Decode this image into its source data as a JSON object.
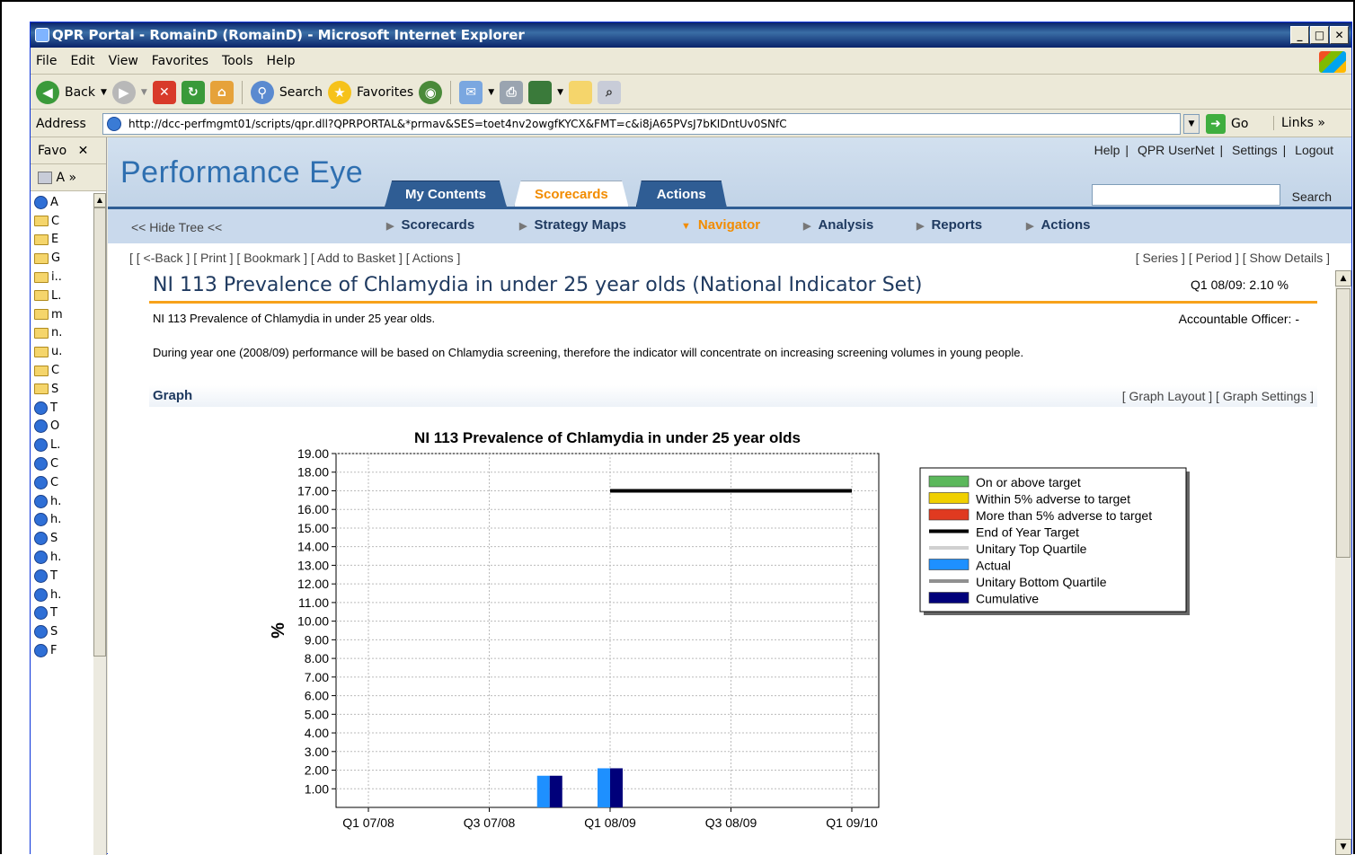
{
  "window": {
    "title": "QPR Portal - RomainD (RomainD) - Microsoft Internet Explorer",
    "buttons": [
      "_",
      "□",
      "✕"
    ]
  },
  "menu": [
    "File",
    "Edit",
    "View",
    "Favorites",
    "Tools",
    "Help"
  ],
  "toolbar": {
    "back": "Back",
    "search": "Search",
    "favorites": "Favorites"
  },
  "address": {
    "label": "Address",
    "url": "http://dcc-perfmgmt01/scripts/qpr.dll?QPRPORTAL&*prmav&SES=toet4nv2owgfKYCX&FMT=c&i8jA65PVsJ7bKIDntUv0SNfC",
    "go": "Go",
    "links": "Links"
  },
  "favorites": {
    "header": "Favo",
    "close": "✕",
    "sub": "A",
    "items": [
      {
        "type": "ie",
        "label": "A"
      },
      {
        "type": "folder",
        "label": "C"
      },
      {
        "type": "folder",
        "label": "E"
      },
      {
        "type": "folder",
        "label": "G"
      },
      {
        "type": "folder",
        "label": "i.."
      },
      {
        "type": "folder",
        "label": "L."
      },
      {
        "type": "folder",
        "label": "m"
      },
      {
        "type": "folder",
        "label": "n."
      },
      {
        "type": "folder",
        "label": "u."
      },
      {
        "type": "folder",
        "label": "C"
      },
      {
        "type": "folder",
        "label": "S"
      },
      {
        "type": "ie",
        "label": "T"
      },
      {
        "type": "ie",
        "label": "O"
      },
      {
        "type": "ie",
        "label": "L."
      },
      {
        "type": "ie",
        "label": "C"
      },
      {
        "type": "ie",
        "label": "C"
      },
      {
        "type": "ie",
        "label": "h."
      },
      {
        "type": "ie",
        "label": "h."
      },
      {
        "type": "ie",
        "label": "S"
      },
      {
        "type": "ie",
        "label": "h."
      },
      {
        "type": "ie",
        "label": "T"
      },
      {
        "type": "ie",
        "label": "h."
      },
      {
        "type": "ie",
        "label": "T"
      },
      {
        "type": "ie",
        "label": "S"
      },
      {
        "type": "ie",
        "label": "F"
      }
    ]
  },
  "portal": {
    "brand": "Performance Eye",
    "toplinks": [
      "Help",
      "QPR UserNet",
      "Settings",
      "Logout"
    ],
    "search_label": "Search",
    "tabs": [
      {
        "label": "My Contents",
        "active": false
      },
      {
        "label": "Scorecards",
        "active": true
      },
      {
        "label": "Actions",
        "active": false
      }
    ],
    "hide_tree": "<< Hide Tree <<",
    "subnav": [
      {
        "label": "Scorecards",
        "active": false
      },
      {
        "label": "Strategy Maps",
        "active": false
      },
      {
        "label": "Navigator",
        "active": true
      },
      {
        "label": "Analysis",
        "active": false
      },
      {
        "label": "Reports",
        "active": false
      },
      {
        "label": "Actions",
        "active": false
      }
    ],
    "actions_left": "[ [ <-Back ] [ Print ] [ Bookmark ] [ Add to Basket ] [ Actions ]",
    "actions_right": "[ Series ] [ Period ] [ Show Details ]"
  },
  "indicator": {
    "title": "NI 113 Prevalence of Chlamydia in under 25 year olds (National Indicator Set)",
    "value": "Q1 08/09: 2.10 %",
    "short": "NI 113 Prevalence of Chlamydia in under 25 year olds.",
    "officer": "Accountable Officer: -",
    "description": "During year one (2008/09) performance will be based on Chlamydia screening, therefore the indicator will concentrate on increasing screening volumes in young people.",
    "graph_label": "Graph",
    "graph_links": "[ Graph Layout ] [ Graph Settings ]"
  },
  "colors": {
    "green": "#5cb85c",
    "yellow": "#f0d000",
    "red": "#e03a20",
    "black": "#000000",
    "toplight": "#d0d0d0",
    "actual": "#1e90ff",
    "bottomgray": "#909090",
    "cumulative": "#00007a"
  },
  "chart_data": {
    "type": "bar",
    "title": "NI 113 Prevalence of Chlamydia in under 25 year olds",
    "ylabel": "%",
    "ylim": [
      0,
      19
    ],
    "yticks": [
      "1.00",
      "2.00",
      "3.00",
      "4.00",
      "5.00",
      "6.00",
      "7.00",
      "8.00",
      "9.00",
      "10.00",
      "11.00",
      "12.00",
      "13.00",
      "14.00",
      "15.00",
      "16.00",
      "17.00",
      "18.00",
      "19.00"
    ],
    "xticks": [
      "Q1 07/08",
      "Q3 07/08",
      "Q1 08/09",
      "Q3 08/09",
      "Q1 09/10"
    ],
    "grid": true,
    "legend_position": "right",
    "legend": [
      {
        "label": "On or above target",
        "kind": "box",
        "color": "#5cb85c"
      },
      {
        "label": "Within 5% adverse to target",
        "kind": "box",
        "color": "#f0d000"
      },
      {
        "label": "More than 5% adverse to target",
        "kind": "box",
        "color": "#e03a20"
      },
      {
        "label": "End of Year Target",
        "kind": "line",
        "color": "#000000"
      },
      {
        "label": "Unitary Top Quartile",
        "kind": "line",
        "color": "#d0d0d0"
      },
      {
        "label": "Actual",
        "kind": "box",
        "color": "#1e90ff"
      },
      {
        "label": "Unitary Bottom Quartile",
        "kind": "line",
        "color": "#909090"
      },
      {
        "label": "Cumulative",
        "kind": "box",
        "color": "#00007a"
      }
    ],
    "bars": [
      {
        "period": "Q4 07/08",
        "actual": 1.7,
        "cumulative": 1.7
      },
      {
        "period": "Q1 08/09",
        "actual": 2.1,
        "cumulative": 2.1
      }
    ],
    "target": {
      "label": "End of Year Target",
      "value": 17.0,
      "from": "Q1 08/09",
      "to": "Q1 09/10"
    }
  }
}
